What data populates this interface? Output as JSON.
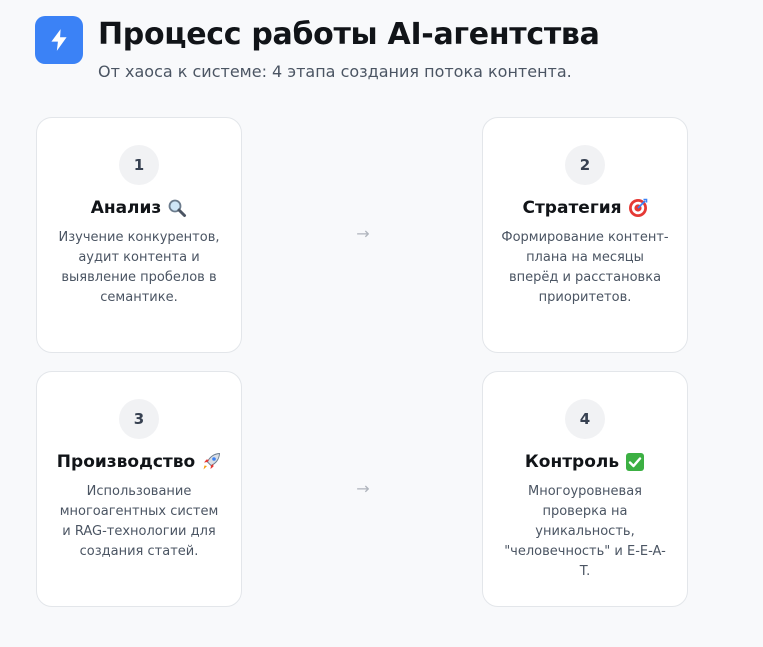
{
  "header": {
    "title": "Процесс работы AI-агентства",
    "subtitle": "От хаоса к системе: 4 этапа создания потока контента.",
    "logo_icon": "lightning-icon",
    "accent_color": "#3b82f6"
  },
  "steps": [
    {
      "number": "1",
      "title": "Анализ",
      "icon": "magnifier-icon",
      "description": "Изучение конкурентов, аудит контента и выявление пробелов в семантике."
    },
    {
      "number": "2",
      "title": "Стратегия",
      "icon": "target-icon",
      "description": "Формирование контент-плана на месяцы вперёд и расстановка приоритетов."
    },
    {
      "number": "3",
      "title": "Производство",
      "icon": "rocket-icon",
      "description": "Использование многоагентных систем и RAG-технологии для создания статей."
    },
    {
      "number": "4",
      "title": "Контроль",
      "icon": "check-mark-icon",
      "description": "Многоуровневая проверка на уникальность, \"человечность\" и E-E-A-T."
    }
  ],
  "arrows": [
    "→",
    "→"
  ]
}
